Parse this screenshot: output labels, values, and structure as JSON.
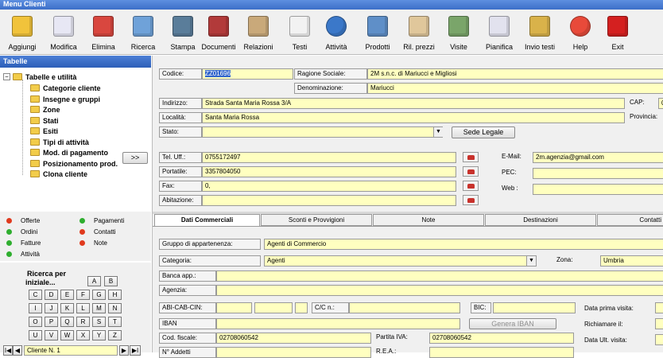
{
  "window": {
    "title": "Menu Clienti"
  },
  "toolbar": [
    {
      "label": "Aggiungi",
      "icon": "folder-open-icon"
    },
    {
      "label": "Modifica",
      "icon": "edit-check-icon"
    },
    {
      "label": "Elimina",
      "icon": "delete-icon"
    },
    {
      "label": "Ricerca",
      "icon": "magnifier-icon"
    },
    {
      "label": "Stampa",
      "icon": "printer-icon"
    },
    {
      "label": "Documenti",
      "icon": "book-icon"
    },
    {
      "label": "Relazioni",
      "icon": "relations-icon"
    },
    {
      "label": "Testi",
      "icon": "text-doc-icon"
    },
    {
      "label": "Attività",
      "icon": "compass-icon"
    },
    {
      "label": "Prodotti",
      "icon": "folders-icon"
    },
    {
      "label": "Ril. prezzi",
      "icon": "clipboard-icon"
    },
    {
      "label": "Visite",
      "icon": "visits-icon"
    },
    {
      "label": "Pianifica",
      "icon": "notebook-icon"
    },
    {
      "label": "Invio testi",
      "icon": "send-folder-icon"
    },
    {
      "label": "Help",
      "icon": "lifebuoy-icon"
    },
    {
      "label": "Exit",
      "icon": "power-icon"
    }
  ],
  "sidebar": {
    "header": "Tabelle",
    "root": "Tabelle e utilità",
    "expander": "−",
    "items": [
      "Categorie cliente",
      "Insegne e gruppi",
      "Zone",
      "Stati",
      "Esiti",
      "Tipi di attività",
      "Mod. di pagamento",
      "Posizionamento prod.",
      "Clona cliente"
    ],
    "go_button": ">>"
  },
  "legend": {
    "items": [
      {
        "label": "Offerte",
        "color": "#e03a1e"
      },
      {
        "label": "Ordini",
        "color": "#2fae2f"
      },
      {
        "label": "Fatture",
        "color": "#2fae2f"
      },
      {
        "label": "Attività",
        "color": "#2fae2f"
      },
      {
        "label": "Pagamenti",
        "color": "#2fae2f"
      },
      {
        "label": "Contatti",
        "color": "#e03a1e"
      },
      {
        "label": "Note",
        "color": "#e03a1e"
      }
    ]
  },
  "search": {
    "label_line1": "Ricerca per",
    "label_line2": "iniziale...",
    "keys": [
      "A",
      "B",
      "C",
      "D",
      "E",
      "F",
      "G",
      "H",
      "I",
      "J",
      "K",
      "L",
      "M",
      "N",
      "O",
      "P",
      "Q",
      "R",
      "S",
      "T",
      "U",
      "V",
      "W",
      "X",
      "Y",
      "Z"
    ],
    "nav_first": "I◀",
    "nav_prev": "◀",
    "nav_next": "▶",
    "nav_last": "▶I",
    "current": "Cliente N. 1"
  },
  "form": {
    "codice": {
      "label": "Codice:",
      "value": "ZZ01696"
    },
    "ragione": {
      "label": "Ragione Sociale:",
      "value": "2M s.n.c. di Mariucci e Migliosi"
    },
    "denominazione": {
      "label": "Denominazione:",
      "value": "Mariucci"
    },
    "indirizzo": {
      "label": "Indirizzo:",
      "value": "Strada Santa Maria Rossa 3/A"
    },
    "cap": {
      "label": "CAP:",
      "value": "0"
    },
    "localita": {
      "label": "Località:",
      "value": "Santa Maria Rossa"
    },
    "provincia": {
      "label": "Provincia:",
      "value": ""
    },
    "stato": {
      "label": "Stato:",
      "value": ""
    },
    "sede_button": "Sede Legale",
    "tel": {
      "label": "Tel. Uff.:",
      "value": "0755172497"
    },
    "portatile": {
      "label": "Portatile:",
      "value": "3357804050"
    },
    "fax": {
      "label": "Fax:",
      "value": "0,"
    },
    "abitazione": {
      "label": "Abitazione:",
      "value": ""
    },
    "email": {
      "label": "E-Mail:",
      "value": "2m.agenzia@gmail.com"
    },
    "pec": {
      "label": "PEC:",
      "value": ""
    },
    "web": {
      "label": "Web :",
      "value": ""
    }
  },
  "tabs": [
    "Dati Commerciali",
    "Sconti e Provvigioni",
    "Note",
    "Destinazioni",
    "Contatti"
  ],
  "commerciali": {
    "gruppo": {
      "label": "Gruppo di appartenenza:",
      "value": "Agenti di Commercio"
    },
    "categoria": {
      "label": "Categoria:",
      "value": "Agenti"
    },
    "zona": {
      "label": "Zona:",
      "value": "Umbria"
    },
    "banca": {
      "label": "Banca app.:",
      "value": ""
    },
    "agenzia": {
      "label": "Agenzia:",
      "value": ""
    },
    "abi": {
      "label": "ABI-CAB-CIN:"
    },
    "cc": {
      "label": "C/C n.:"
    },
    "bic": {
      "label": "BIC:"
    },
    "iban": {
      "label": "IBAN"
    },
    "genera_iban": "Genera IBAN",
    "cod_fiscale": {
      "label": "Cod. fiscale:",
      "value": "02708060542"
    },
    "partita_iva": {
      "label": "Partita IVA:",
      "value": "02708060542"
    },
    "addetti": {
      "label": "N° Addetti"
    },
    "rea": {
      "label": "R.E.A.:"
    },
    "data_prima_visita": {
      "label": "Data prima visita:"
    },
    "richiamare": {
      "label": "Richiamare il:"
    },
    "data_ult_visita": {
      "label": "Data Ult. visita:"
    }
  }
}
